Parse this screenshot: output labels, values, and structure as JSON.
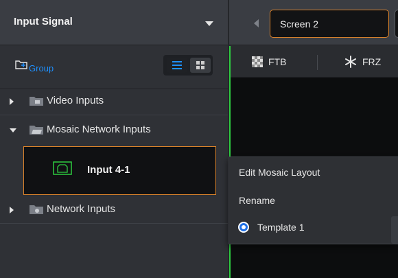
{
  "left_panel": {
    "title": "Input Signal",
    "group_button_label": "Group",
    "view_modes": [
      "list",
      "grid"
    ],
    "tree": [
      {
        "label": "Video Inputs",
        "expanded": false,
        "icon": "video-folder-icon"
      },
      {
        "label": "Mosaic Network Inputs",
        "expanded": true,
        "icon": "mosaic-folder-icon",
        "children": [
          {
            "label": "Input 4-1",
            "selected": true,
            "icon": "input-source-icon"
          }
        ]
      },
      {
        "label": "Network Inputs",
        "expanded": false,
        "icon": "network-folder-icon"
      }
    ]
  },
  "screen_tabs": {
    "active": "Screen 2"
  },
  "canvas_toolbar": {
    "ftb_label": "FTB",
    "frz_label": "FRZ"
  },
  "context_menu": {
    "items": [
      "Edit Mosaic Layout",
      "Rename"
    ],
    "templates": [
      {
        "label": "Template 1",
        "selected": true
      }
    ]
  },
  "colors": {
    "accent_blue": "#1e90ff",
    "selection_orange": "#d9822b",
    "canvas_green": "#2ecc40",
    "panel_bg": "#2f3136"
  }
}
